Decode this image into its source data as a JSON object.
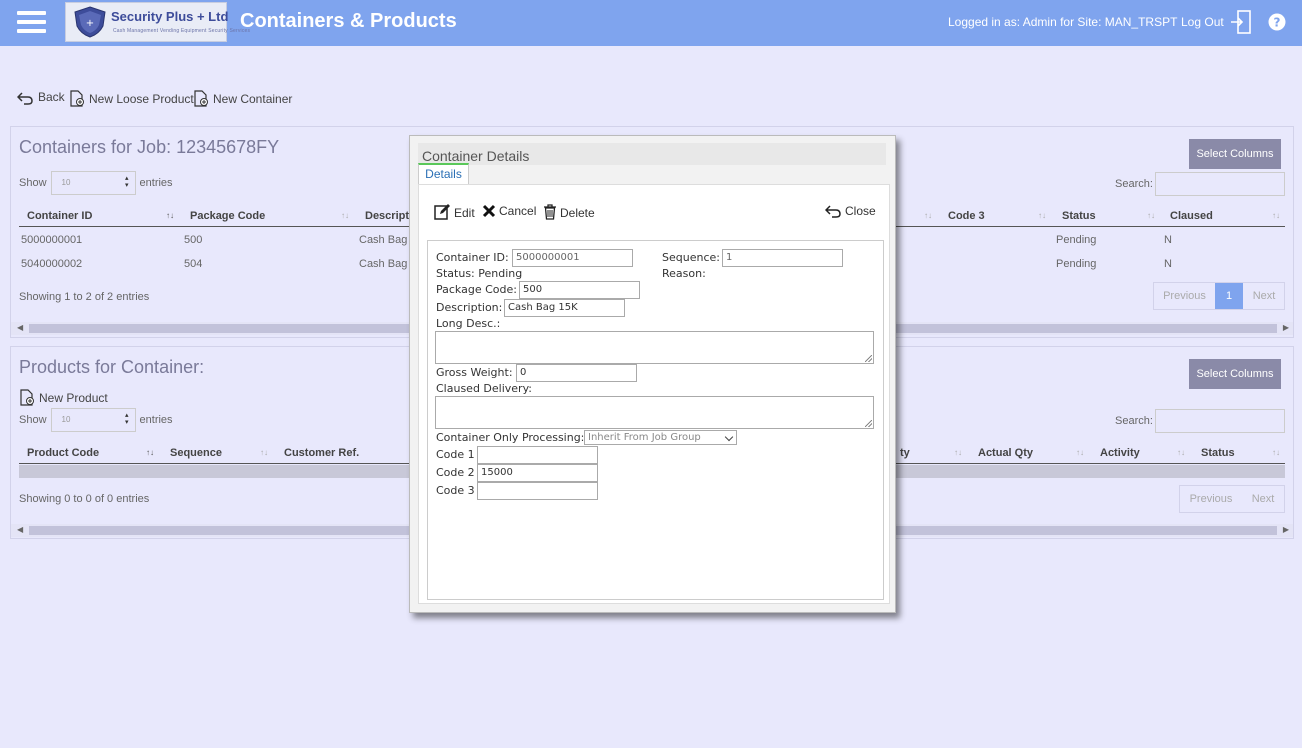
{
  "header": {
    "title": "Containers & Products",
    "logo_brand": "Security Plus + Ltd",
    "logo_tagline": "Cash Management    Vending Equipment    Security Services",
    "login_info": "Logged in as: Admin for Site: MAN_TRSPT",
    "logout_label": "Log Out"
  },
  "toolbar": {
    "back": "Back",
    "new_loose_product": "New Loose Product",
    "new_container": "New Container"
  },
  "containers": {
    "title": "Containers for Job: 12345678FY",
    "select_columns": "Select Columns",
    "show_label": "Show",
    "show_value": "10",
    "entries_label": "entries",
    "search_label": "Search:",
    "columns": [
      "Container ID",
      "Package Code",
      "Descript",
      "Code 3",
      "Status",
      "Claused"
    ],
    "rows": [
      {
        "id": "5000000001",
        "package": "500",
        "desc": "Cash Bag",
        "status": "Pending",
        "claused": "N"
      },
      {
        "id": "5040000002",
        "package": "504",
        "desc": "Cash Bag",
        "status": "Pending",
        "claused": "N"
      }
    ],
    "info": "Showing 1 to 2 of 2 entries",
    "pager": {
      "previous": "Previous",
      "current": "1",
      "next": "Next"
    }
  },
  "products": {
    "title": "Products for Container:",
    "new_product": "New Product",
    "select_columns": "Select Columns",
    "show_label": "Show",
    "show_value": "10",
    "entries_label": "entries",
    "search_label": "Search:",
    "columns": [
      "Product Code",
      "Sequence",
      "Customer Ref.",
      "ty",
      "Actual Qty",
      "Activity",
      "Status"
    ],
    "info": "Showing 0 to 0 of 0 entries",
    "pager": {
      "previous": "Previous",
      "next": "Next"
    }
  },
  "modal": {
    "title": "Container Details",
    "tab": "Details",
    "edit": "Edit",
    "cancel": "Cancel",
    "delete": "Delete",
    "close": "Close",
    "form": {
      "container_id_label": "Container ID:",
      "container_id": "5000000001",
      "sequence_label": "Sequence:",
      "sequence": "1",
      "status_label": "Status: Pending",
      "reason_label": "Reason:",
      "package_code_label": "Package Code:",
      "package_code": "500",
      "description_label": "Description:",
      "description": "Cash Bag 15K",
      "long_desc_label": "Long Desc.:",
      "gross_weight_label": "Gross Weight:",
      "gross_weight": "0",
      "claused_delivery_label": "Claused Delivery:",
      "container_only_label": "Container Only Processing:",
      "container_only_value": "Inherit From Job Group",
      "code1_label": "Code 1",
      "code1": "",
      "code2_label": "Code 2",
      "code2": "15000",
      "code3_label": "Code 3",
      "code3": ""
    }
  },
  "colors": {
    "header_bg": "#7fa4ee",
    "page_bg": "#e8e8fc",
    "select_columns_bg": "#8a8aa8",
    "tab_accent": "#5ac85a"
  }
}
